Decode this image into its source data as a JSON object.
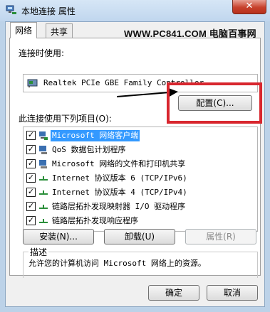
{
  "window": {
    "title": "本地连接 属性",
    "close_glyph": "✕"
  },
  "tabs": [
    {
      "label": "网络"
    },
    {
      "label": "共享"
    }
  ],
  "watermark": "WWW.PC841.COM 电脑百事网",
  "connect_using": {
    "label": "连接时使用:",
    "adapter": "Realtek PCIe GBE Family Controller",
    "configure_button": "配置(C)..."
  },
  "items_section": {
    "label": "此连接使用下列项目(O):",
    "items": [
      {
        "label": "Microsoft 网络客户端",
        "checked": true,
        "selected": true,
        "icon": "network-client-icon"
      },
      {
        "label": "QoS 数据包计划程序",
        "checked": true,
        "selected": false,
        "icon": "qos-icon"
      },
      {
        "label": "Microsoft 网络的文件和打印机共享",
        "checked": true,
        "selected": false,
        "icon": "file-printer-share-icon"
      },
      {
        "label": "Internet 协议版本 6 (TCP/IPv6)",
        "checked": true,
        "selected": false,
        "icon": "protocol-icon"
      },
      {
        "label": "Internet 协议版本 4 (TCP/IPv4)",
        "checked": true,
        "selected": false,
        "icon": "protocol-icon"
      },
      {
        "label": "链路层拓扑发现映射器 I/O 驱动程序",
        "checked": true,
        "selected": false,
        "icon": "protocol-icon"
      },
      {
        "label": "链路层拓扑发现响应程序",
        "checked": true,
        "selected": false,
        "icon": "protocol-icon"
      }
    ]
  },
  "action_buttons": {
    "install": "安装(N)...",
    "uninstall": "卸载(U)",
    "properties": "属性(R)"
  },
  "description": {
    "title": "描述",
    "text": "允许您的计算机访问 Microsoft 网络上的资源。"
  },
  "footer": {
    "ok": "确定",
    "cancel": "取消"
  },
  "annotation": {
    "highlight_color": "#d8262e",
    "arrow_color": "#000000"
  }
}
